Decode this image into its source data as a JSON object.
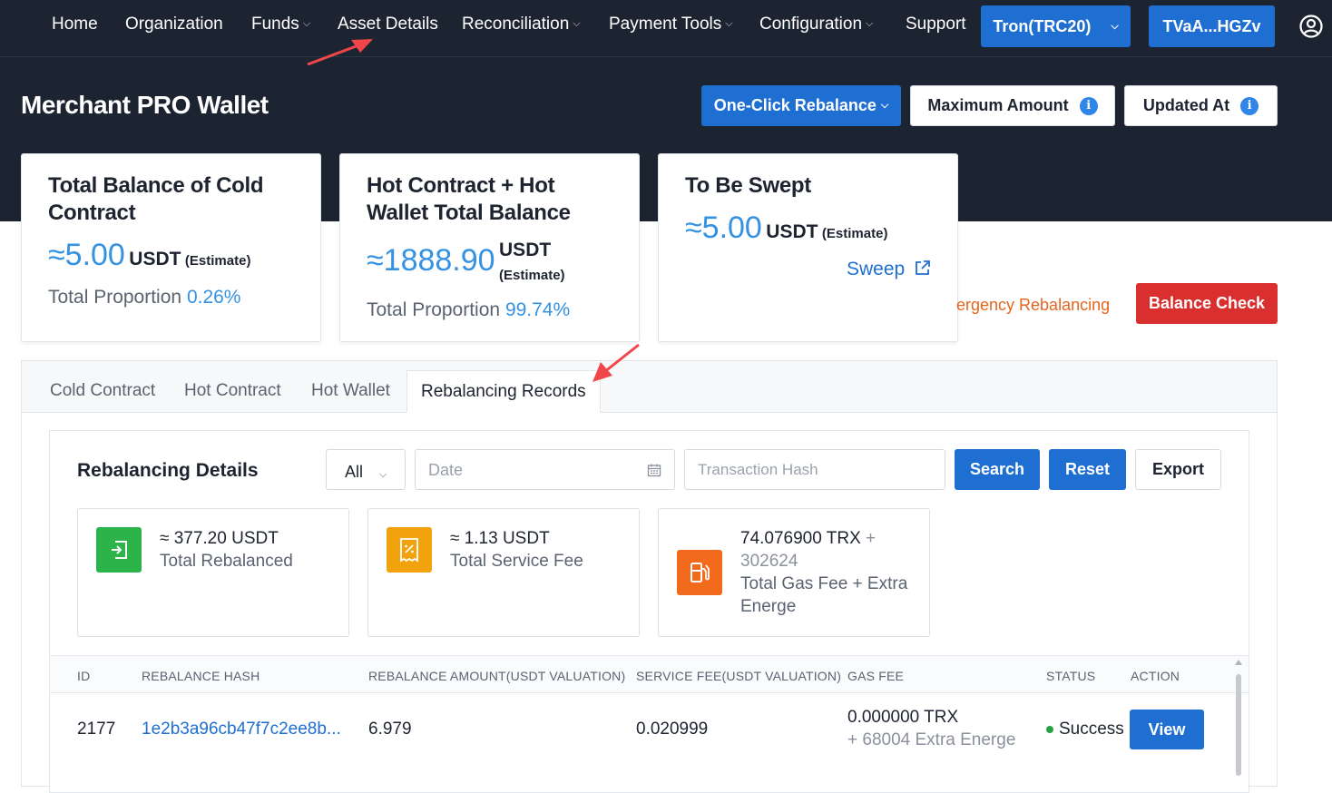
{
  "nav": {
    "home": "Home",
    "organization": "Organization",
    "funds": "Funds",
    "asset_details": "Asset Details",
    "reconciliation": "Reconciliation",
    "payment_tools": "Payment Tools",
    "configuration": "Configuration",
    "support": "Support",
    "network": "Tron(TRC20)",
    "address": "TVaA...HGZv"
  },
  "header": {
    "title": "Merchant PRO Wallet",
    "one_click": "One-Click Rebalance",
    "max_amount": "Maximum Amount",
    "updated_at": "Updated At"
  },
  "cards": {
    "cold": {
      "title_1": "Total Balance of Cold",
      "title_2": "Contract",
      "approx": "≈5.00",
      "unit": "USDT",
      "estimate": "(Estimate)",
      "prop_label": "Total Proportion",
      "prop_value": "0.26%"
    },
    "hot": {
      "title_1": "Hot Contract + Hot",
      "title_2": "Wallet Total Balance",
      "approx": "≈1888.90",
      "unit": "USDT",
      "estimate": "(Estimate)",
      "prop_label": "Total Proportion",
      "prop_value": "99.74%"
    },
    "sweep": {
      "title": "To Be Swept",
      "approx": "≈5.00",
      "unit": "USDT",
      "estimate": "(Estimate)",
      "link": "Sweep"
    }
  },
  "emergency": "ergency Rebalancing",
  "balance_check": "Balance Check",
  "tabs": [
    "Cold Contract",
    "Hot Contract",
    "Hot Wallet",
    "Rebalancing Records"
  ],
  "details": {
    "title": "Rebalancing Details",
    "filter_value": "All",
    "date_placeholder": "Date",
    "hash_placeholder": "Transaction Hash",
    "search": "Search",
    "reset": "Reset",
    "export": "Export"
  },
  "stats": {
    "rebalanced": {
      "value": "≈ 377.20 USDT",
      "label": "Total Rebalanced"
    },
    "service_fee": {
      "value": "≈ 1.13 USDT",
      "label": "Total Service Fee"
    },
    "gas": {
      "value": "74.076900 TRX",
      "plus": "+",
      "extra": "302624",
      "label_1": "Total Gas Fee + Extra",
      "label_2": "Energe"
    }
  },
  "table": {
    "headers": [
      "ID",
      "REBALANCE HASH",
      "REBALANCE AMOUNT(USDT VALUATION)",
      "SERVICE FEE(USDT VALUATION)",
      "GAS FEE",
      "STATUS",
      "ACTION"
    ],
    "rows": [
      {
        "id": "2177",
        "hash": "1e2b3a96cb47f7c2ee8b...",
        "amount": "6.979",
        "fee": "0.020999",
        "gas": "0.000000 TRX",
        "gas_extra": "+ 68004 Extra Energe",
        "status": "Success",
        "action": "View"
      }
    ]
  },
  "colors": {
    "dark_bg": "#1d2431",
    "primary": "#1e6fd1",
    "accent_value": "#3592e2",
    "danger": "#d9302f",
    "warning_text": "#e5651f",
    "success": "#25a244",
    "annotation_arrow": "#f0464a"
  }
}
